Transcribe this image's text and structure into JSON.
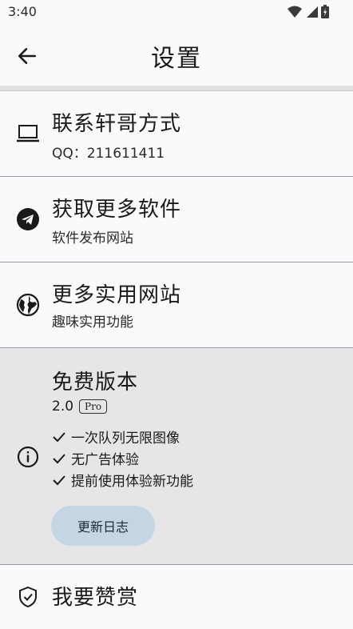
{
  "status_bar": {
    "time": "3:40"
  },
  "header": {
    "title": "设置"
  },
  "items": [
    {
      "title": "联系轩哥方式",
      "subtitle": "QQ：211611411"
    },
    {
      "title": "获取更多软件",
      "subtitle": "软件发布网站"
    },
    {
      "title": "更多实用网站",
      "subtitle": "趣味实用功能"
    }
  ],
  "free_version": {
    "title": "免费版本",
    "version": "2.0",
    "badge": "Pro",
    "features": [
      "一次队列无限图像",
      "无广告体验",
      "提前使用体验新功能"
    ],
    "changelog_button": "更新日志",
    "background_color": "#e6e6e8",
    "button_color": "#c4d6e4"
  },
  "donate": {
    "title": "我要赞赏"
  }
}
